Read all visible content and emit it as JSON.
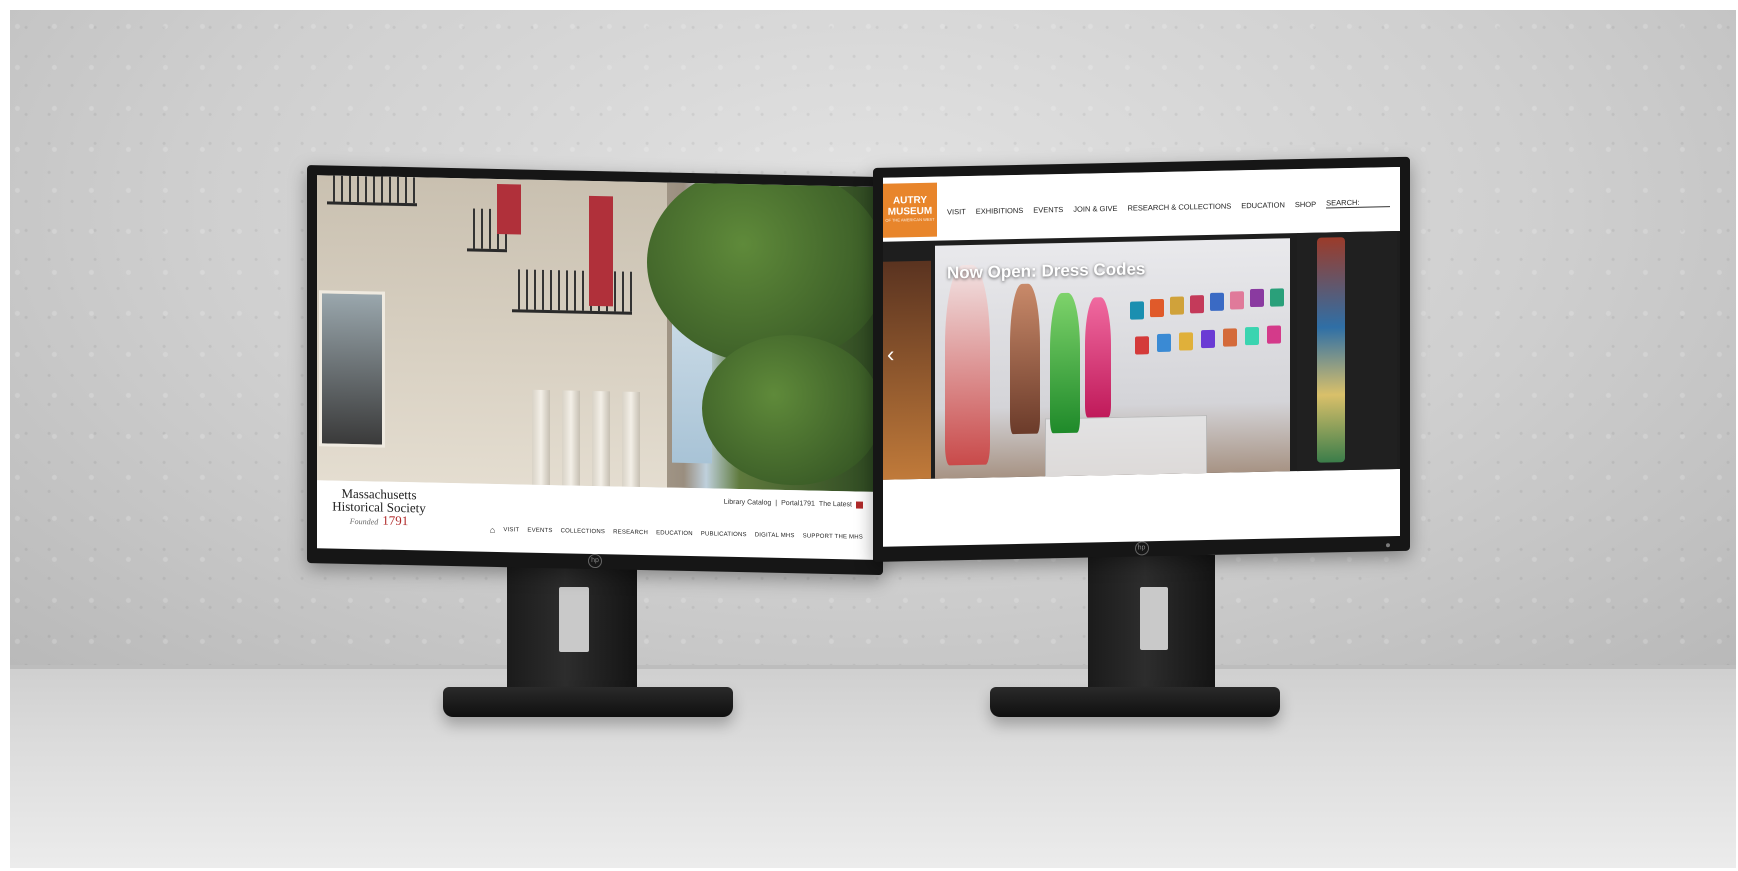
{
  "left_monitor": {
    "site": "Massachusetts Historical Society",
    "logo": {
      "line1": "Massachusetts",
      "line2": "Historical Society",
      "founded": "Founded",
      "year": "1791"
    },
    "utility_links": [
      "Library Catalog",
      "Portal1791",
      "The Latest"
    ],
    "utility_separator": "|",
    "nav": [
      "VISIT",
      "EVENTS",
      "COLLECTIONS",
      "RESEARCH",
      "EDUCATION",
      "PUBLICATIONS",
      "DIGITAL MHS",
      "SUPPORT THE MHS"
    ]
  },
  "right_monitor": {
    "site": "Autry Museum",
    "logo": {
      "line1": "AUTRY",
      "line2": "MUSEUM",
      "tagline": "OF THE AMERICAN WEST"
    },
    "nav": [
      "VISIT",
      "EXHIBITIONS",
      "EVENTS",
      "JOIN & GIVE",
      "RESEARCH & COLLECTIONS",
      "EDUCATION",
      "SHOP"
    ],
    "search_label": "SEARCH:",
    "hero_title": "Now Open: Dress Codes",
    "colors": {
      "logo_orange": "#e8852b"
    }
  },
  "icons": {
    "home": "home-icon",
    "search": "search-icon",
    "prev": "chevron-left-icon",
    "latest": "red-square-icon"
  }
}
